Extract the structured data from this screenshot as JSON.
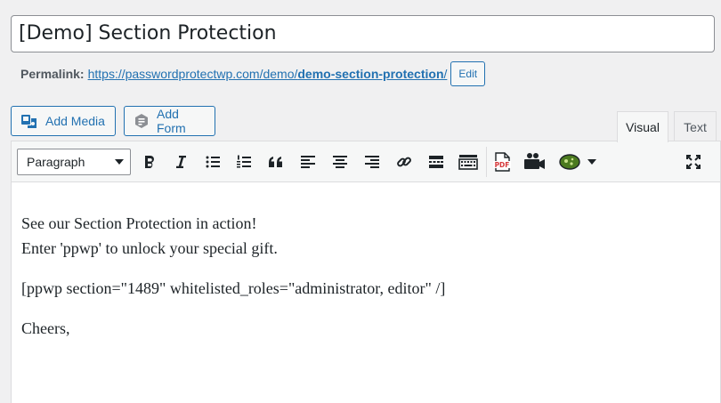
{
  "post": {
    "title": "[Demo] Section Protection"
  },
  "permalink": {
    "label": "Permalink:",
    "url_base": "https://passwordprotectwp.com/demo/",
    "slug": "demo-section-protection",
    "url_end": "/",
    "edit_label": "Edit"
  },
  "media_buttons": {
    "add_media": "Add Media",
    "add_form": "Add Form"
  },
  "editor_tabs": {
    "visual": "Visual",
    "text": "Text",
    "active": "Visual"
  },
  "toolbar": {
    "format_selected": "Paragraph",
    "icons": [
      "bold-icon",
      "italic-icon",
      "bulleted-list-icon",
      "numbered-list-icon",
      "blockquote-icon",
      "align-left-icon",
      "align-center-icon",
      "align-right-icon",
      "link-icon",
      "read-more-icon",
      "toolbar-toggle-icon",
      "pdf-icon",
      "video-camera-icon",
      "plugin-shortcode-icon",
      "fullscreen-icon"
    ]
  },
  "content": {
    "line1": "See our Section Protection in action!",
    "line2": "Enter 'ppwp' to unlock your special gift.",
    "shortcode": "[ppwp section=\"1489\" whitelisted_roles=\"administrator, editor\" /]",
    "closing": "Cheers,"
  },
  "colors": {
    "accent": "#2271b1",
    "pdf_red": "#d63638",
    "plugin_green": "#4b7a1f"
  }
}
